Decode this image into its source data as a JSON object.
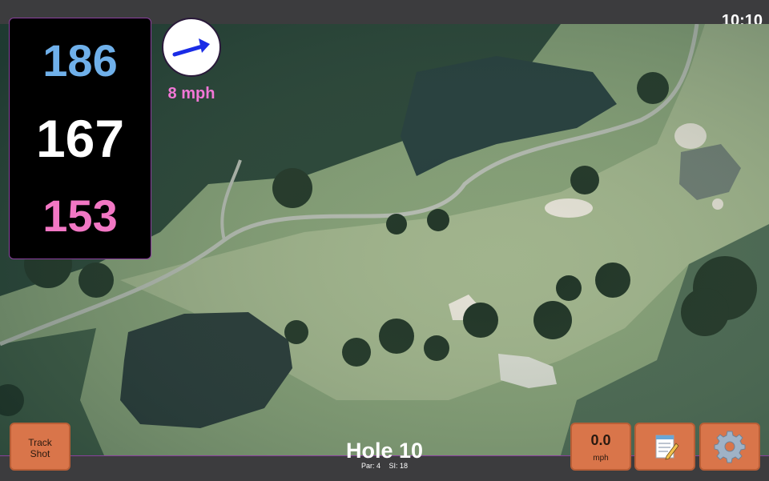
{
  "status": {
    "time": "10:10"
  },
  "distances": {
    "back": "186",
    "middle": "167",
    "front": "153"
  },
  "wind": {
    "speed": "8 mph",
    "direction_icon": "wind-arrow-icon"
  },
  "hole": {
    "title": "Hole 10",
    "par": "Par: 4",
    "stroke_index": "SI: 18"
  },
  "buttons": {
    "track_line1": "Track",
    "track_line2": "Shot",
    "speed_value": "0.0",
    "speed_unit": "mph",
    "notes_icon": "notepad-icon",
    "settings_icon": "gear-icon"
  },
  "colors": {
    "back": "#6fb0ea",
    "middle": "#ffffff",
    "front": "#f277c4",
    "accent": "#8a3f9e",
    "button": "#d9754a"
  }
}
